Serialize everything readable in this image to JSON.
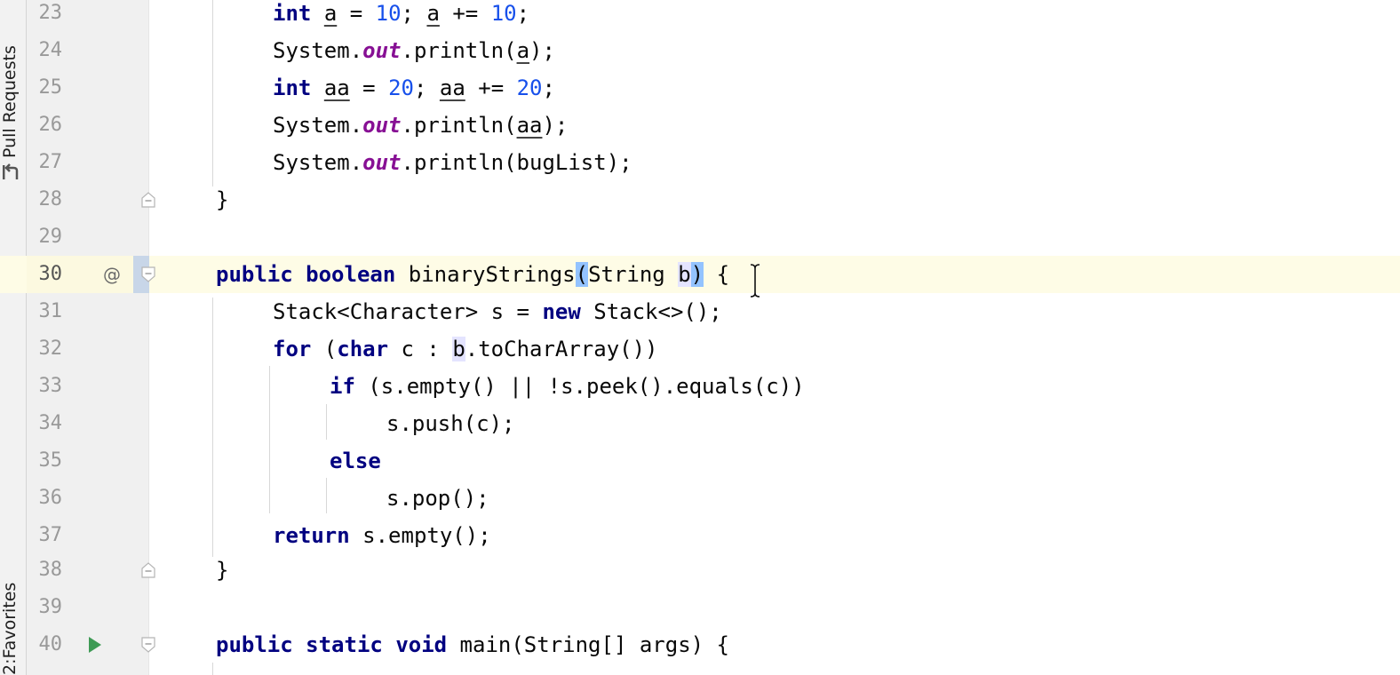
{
  "sidebar": {
    "pull_requests": "Pull Requests",
    "favorites": "Favorites",
    "favorites_prefix": "2:"
  },
  "editor": {
    "current_line": 30,
    "lines": [
      {
        "n": "23"
      },
      {
        "n": "24"
      },
      {
        "n": "25"
      },
      {
        "n": "26"
      },
      {
        "n": "27"
      },
      {
        "n": "28"
      },
      {
        "n": "29"
      },
      {
        "n": "30"
      },
      {
        "n": "31"
      },
      {
        "n": "32"
      },
      {
        "n": "33"
      },
      {
        "n": "34"
      },
      {
        "n": "35"
      },
      {
        "n": "36"
      },
      {
        "n": "37"
      },
      {
        "n": "38"
      },
      {
        "n": "39"
      },
      {
        "n": "40"
      }
    ],
    "gutter_markers": {
      "line30": "@"
    },
    "code": {
      "l23": [
        "int",
        " ",
        "a",
        " = ",
        "10",
        "; ",
        "a",
        " += ",
        "10",
        ";"
      ],
      "l24": [
        "System.",
        "out",
        ".println(",
        "a",
        ");"
      ],
      "l25": [
        "int",
        " ",
        "aa",
        " = ",
        "20",
        "; ",
        "aa",
        " += ",
        "20",
        ";"
      ],
      "l26": [
        "System.",
        "out",
        ".println(",
        "aa",
        ");"
      ],
      "l27": [
        "System.",
        "out",
        ".println(bugList);"
      ],
      "l28": [
        "}"
      ],
      "l30": [
        "public",
        " ",
        "boolean",
        " binaryStrings",
        "(",
        "String ",
        "b",
        ")",
        " {"
      ],
      "l31": [
        "Stack<Character> s = ",
        "new",
        " Stack<>();"
      ],
      "l32": [
        "for",
        " (",
        "char",
        " c : ",
        "b",
        ".toCharArray())"
      ],
      "l33": [
        "if",
        " (s.empty() || !s.peek().equals(c))"
      ],
      "l34": [
        "s.push(c);"
      ],
      "l35": [
        "else"
      ],
      "l36": [
        "s.pop();"
      ],
      "l37": [
        "return",
        " s.empty();"
      ],
      "l38": [
        "}"
      ],
      "l40": [
        "public",
        " ",
        "static",
        " ",
        "void",
        " main(String[] args) {"
      ]
    }
  },
  "colors": {
    "keyword": "#000080",
    "number": "#1750eb",
    "static_field": "#871094",
    "current_line_bg": "#fefce6",
    "brace_match": "#93c3ff",
    "usage_highlight": "#e4e4ff",
    "run_icon": "#3e9a55"
  },
  "icons": {
    "pull_requests": "pull-request-icon",
    "run": "run-gutter-icon",
    "fold": "fold-icon",
    "cursor": "text-cursor-icon"
  }
}
